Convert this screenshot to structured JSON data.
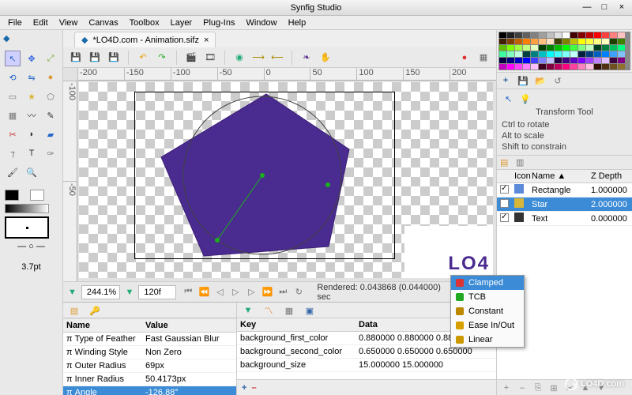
{
  "app_title": "Synfig Studio",
  "menubar": [
    "File",
    "Edit",
    "View",
    "Canvas",
    "Toolbox",
    "Layer",
    "Plug-Ins",
    "Window",
    "Help"
  ],
  "document": {
    "tab_title": "*LO4D.com - Animation.sifz"
  },
  "stroke_width": "3.7pt",
  "ruler_h": [
    "-200",
    "-150",
    "-100",
    "-50",
    "0",
    "50",
    "100",
    "150",
    "200"
  ],
  "ruler_v": [
    "-100",
    "-50"
  ],
  "logo_text": "LO4",
  "status": {
    "zoom": "244.1%",
    "frame": "120f",
    "render_text": "Rendered: 0.043868 (0.044000) sec"
  },
  "popup": {
    "items": [
      "Clamped",
      "TCB",
      "Constant",
      "Ease In/Out",
      "Linear"
    ],
    "selected": 0
  },
  "params": {
    "cols": [
      "Name",
      "Value"
    ],
    "rows": [
      {
        "name": "Type of Feather",
        "value": "Fast Gaussian Blur"
      },
      {
        "name": "Winding Style",
        "value": "Non Zero"
      },
      {
        "name": "Outer Radius",
        "value": "69px"
      },
      {
        "name": "Inner Radius",
        "value": "50.4173px"
      },
      {
        "name": "Angle",
        "value": "-126.88°",
        "sel": true
      }
    ]
  },
  "tracks": {
    "cols": [
      "Key",
      "Data"
    ],
    "rows": [
      {
        "key": "background_first_color",
        "data": "0.880000 0.880000 0.880000"
      },
      {
        "key": "background_second_color",
        "data": "0.650000 0.650000 0.650000"
      },
      {
        "key": "background_size",
        "data": "15.000000 15.000000"
      }
    ]
  },
  "tool_opts": {
    "title": "Transform Tool",
    "lines": [
      "Ctrl to rotate",
      "Alt to scale",
      "Shift to constrain"
    ]
  },
  "layers": {
    "cols": [
      "",
      "Icon",
      "Name ▲",
      "Z Depth"
    ],
    "rows": [
      {
        "on": true,
        "icon": "#5b8bd8",
        "name": "Rectangle",
        "z": "1.000000"
      },
      {
        "on": true,
        "icon": "#d7b63a",
        "name": "Star",
        "z": "2.000000",
        "sel": true
      },
      {
        "on": true,
        "icon": "#333",
        "name": "Text",
        "z": "0.000000"
      }
    ]
  },
  "palette_hex": [
    "#000000",
    "#202020",
    "#404040",
    "#606060",
    "#808080",
    "#a0a0a0",
    "#c0c0c0",
    "#e0e0e0",
    "#ffffff",
    "#400000",
    "#800000",
    "#c00000",
    "#ff0000",
    "#ff4040",
    "#ff8080",
    "#ffc0c0",
    "#402000",
    "#804000",
    "#c06000",
    "#ff8000",
    "#ffa040",
    "#ffc080",
    "#ffe0c0",
    "#404000",
    "#808000",
    "#c0c000",
    "#ffff00",
    "#ffff40",
    "#ffff80",
    "#ffffC0",
    "#204000",
    "#408000",
    "#60c000",
    "#80ff00",
    "#a0ff40",
    "#c0ff80",
    "#e0ffc0",
    "#004000",
    "#008000",
    "#00c000",
    "#00ff00",
    "#40ff40",
    "#80ff80",
    "#c0ffc0",
    "#004020",
    "#008040",
    "#00c060",
    "#00ff80",
    "#40ffa0",
    "#80ffc0",
    "#c0ffe0",
    "#004040",
    "#008080",
    "#00c0c0",
    "#00ffff",
    "#40ffff",
    "#80ffff",
    "#c0ffff",
    "#002040",
    "#004080",
    "#0060c0",
    "#0080ff",
    "#40a0ff",
    "#80c0ff",
    "#000040",
    "#000080",
    "#0000c0",
    "#0000ff",
    "#4040ff",
    "#8080ff",
    "#c0c0ff",
    "#200040",
    "#400080",
    "#6000c0",
    "#8000ff",
    "#a040ff",
    "#c080ff",
    "#e0c0ff",
    "#400040",
    "#800080",
    "#c000c0",
    "#ff00ff",
    "#ff40ff",
    "#ff80ff",
    "#ffc0ff",
    "#400020",
    "#800040",
    "#c00060",
    "#ff0080",
    "#ff40a0",
    "#ff80c0",
    "#ffc0e0",
    "#301000",
    "#503010",
    "#705020",
    "#907030"
  ],
  "watermark": "LO4D.com"
}
